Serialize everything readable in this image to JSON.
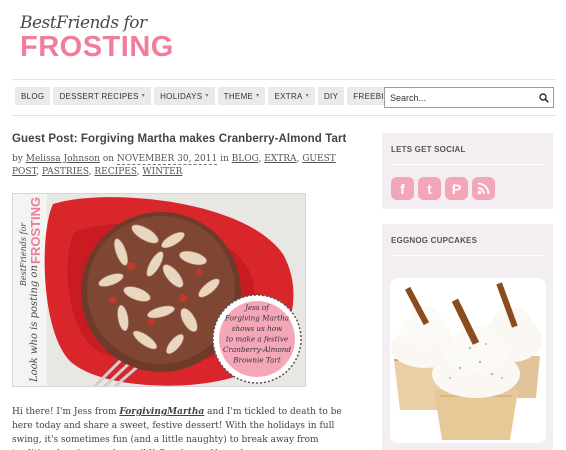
{
  "brand": {
    "line1": "BestFriends for",
    "line2": "FROSTING"
  },
  "nav": [
    {
      "label": "BLOG",
      "dropdown": false
    },
    {
      "label": "DESSERT RECIPES",
      "dropdown": true
    },
    {
      "label": "HOLIDAYS",
      "dropdown": true
    },
    {
      "label": "THEME",
      "dropdown": true
    },
    {
      "label": "EXTRA",
      "dropdown": true
    },
    {
      "label": "DIY",
      "dropdown": false
    },
    {
      "label": "FREEBIES",
      "dropdown": true
    }
  ],
  "search": {
    "placeholder": "Search..."
  },
  "post": {
    "title": "Guest Post: Forgiving Martha makes Cranberry-Almond Tart",
    "by": "by",
    "author": "Melissa Johnson",
    "on": "on",
    "date": "NOVEMBER 30, 2011",
    "in": "in",
    "categories": [
      "BLOG",
      "EXTRA",
      "GUEST POST",
      "PASTRIES",
      "RECIPES",
      "WINTER"
    ],
    "image": {
      "side_logo_1": "BestFriends for",
      "side_logo_2": "FROSTING",
      "side_text": "Look who is posting on",
      "badge": [
        "Jess of",
        "Forgiving Martha",
        "shows us how",
        "to make a festive",
        "Cranberry-Almond",
        "Brownie Tart"
      ]
    },
    "body_intro": "Hi there! I'm Jess from ",
    "body_link": "ForgivingMartha",
    "body_rest": " and I'm tickled to death to be here today and share a sweet, festive dessert!  With the holidays in full swing, it's sometimes fun (and a little naughty) to break away from traditional recipes and go wild!  Cranberry-Almond"
  },
  "sidebar": {
    "social_title": "LETS GET SOCIAL",
    "social_icons": [
      {
        "name": "facebook-icon",
        "glyph": "f"
      },
      {
        "name": "twitter-icon",
        "glyph": "t"
      },
      {
        "name": "pinterest-icon",
        "glyph": "P"
      },
      {
        "name": "rss-icon",
        "glyph": "rss"
      }
    ],
    "eggnog_title": "EGGNOG CUPCAKES"
  },
  "colors": {
    "brand_pink": "#f07d99",
    "widget_bg": "#f3eef2",
    "social_pink": "#f2a6b8",
    "nav_bg": "#eaeaea"
  }
}
